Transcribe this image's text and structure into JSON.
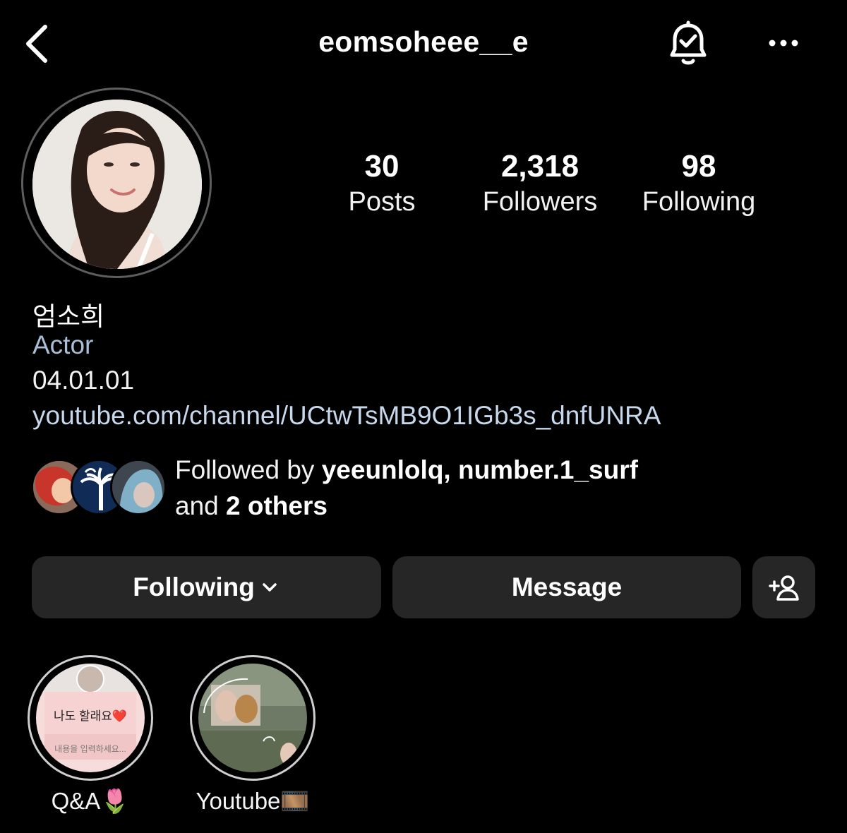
{
  "header": {
    "username": "eomsoheee__e"
  },
  "stats": [
    {
      "value": "30",
      "label": "Posts"
    },
    {
      "value": "2,318",
      "label": "Followers"
    },
    {
      "value": "98",
      "label": "Following"
    }
  ],
  "bio": {
    "name": "엄소희",
    "category": "Actor",
    "line": "04.01.01",
    "link": "youtube.com/channel/UCtwTsMB9O1IGb3s_dnfUNRA"
  },
  "followed_by": {
    "prefix": "Followed by ",
    "users": "yeeunlolq, number.1_surf",
    "and": "and ",
    "others": "2 others"
  },
  "buttons": {
    "following": "Following",
    "message": "Message"
  },
  "highlights": [
    {
      "label": "Q&A🌷",
      "card_title": "나도 할래요❤️",
      "card_sub": "내용을 입력하세요..."
    },
    {
      "label": "Youtube🎞️"
    }
  ],
  "colors": {
    "background": "#000000",
    "button_bg": "#262626",
    "category_text": "#a9bed6",
    "link_text": "#c7d7ec"
  },
  "icons": [
    "chevron-left-icon",
    "bell-check-icon",
    "more-horizontal-icon",
    "chevron-down-icon",
    "add-user-icon"
  ]
}
